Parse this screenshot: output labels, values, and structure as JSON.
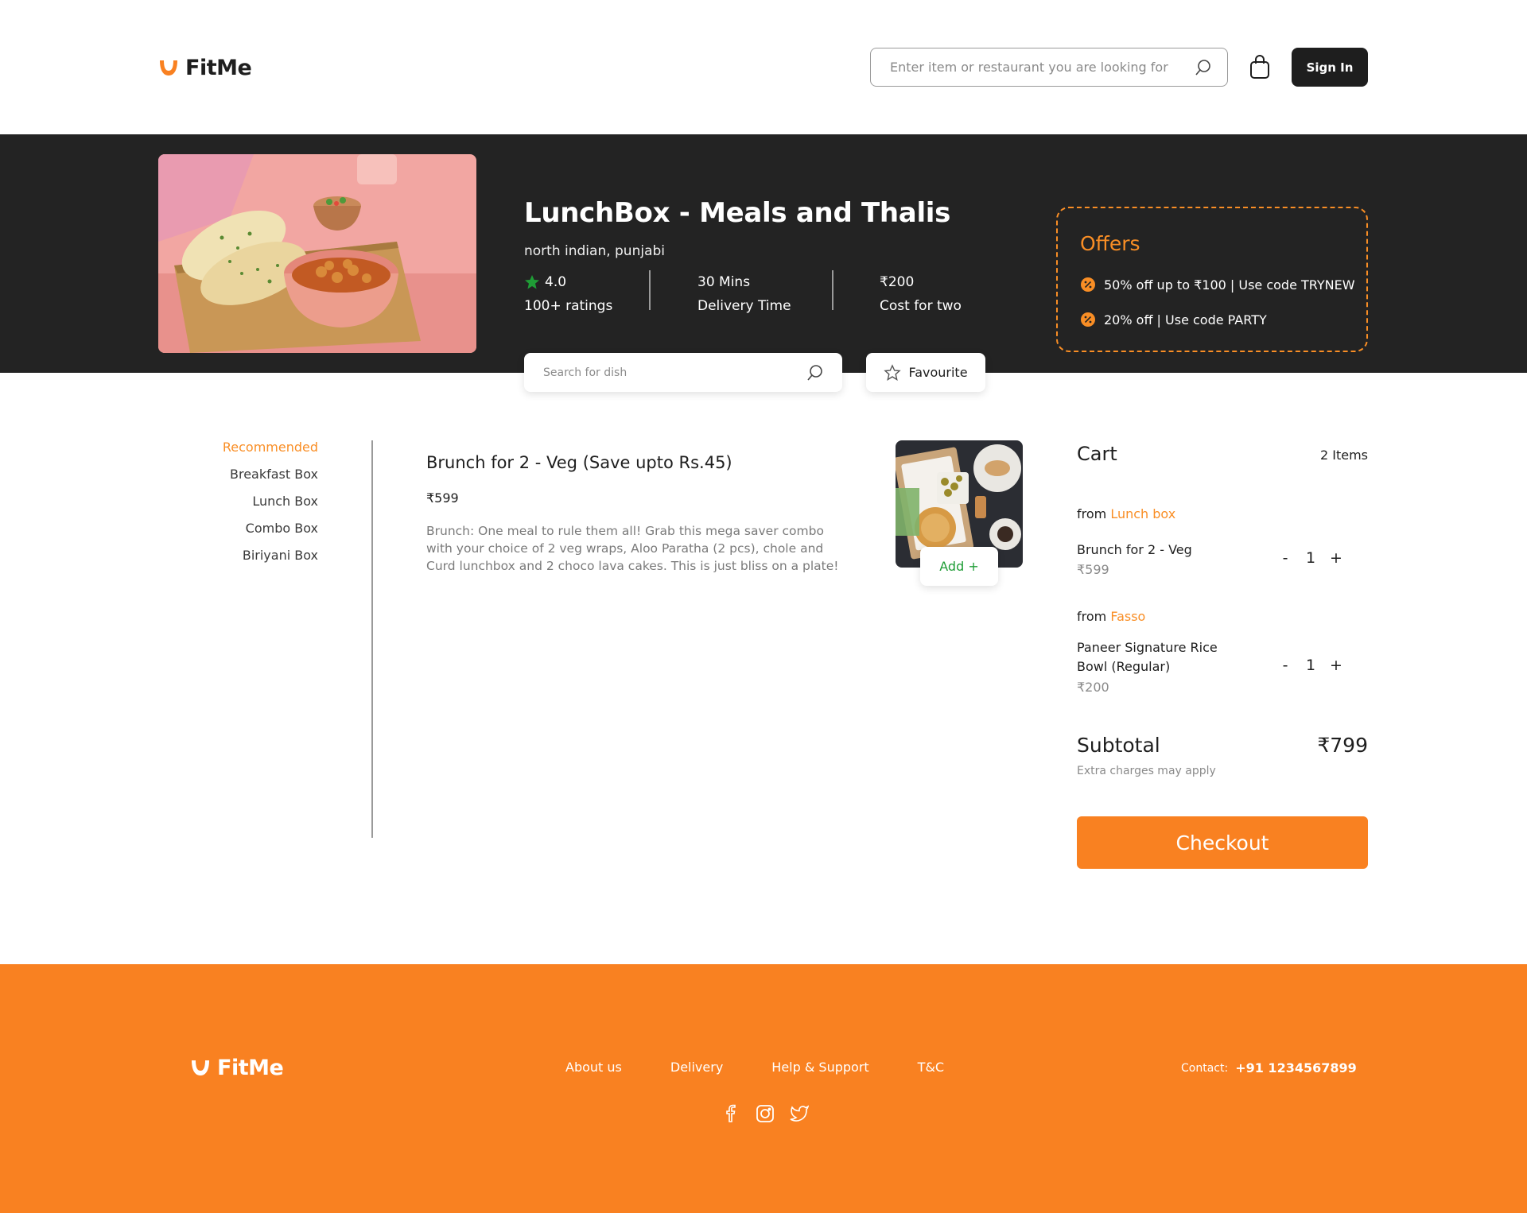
{
  "header": {
    "brand": "FitMe",
    "search_placeholder": "Enter item or restaurant you are looking for",
    "signin_label": "Sign In"
  },
  "restaurant": {
    "name": "LunchBox - Meals and Thalis",
    "cuisine": "north indian, punjabi",
    "rating": "4.0",
    "ratings_count": "100+ ratings",
    "delivery_value": "30 Mins",
    "delivery_label": "Delivery Time",
    "cost_value": "₹200",
    "cost_label": "Cost for two",
    "dish_search_placeholder": "Search for dish",
    "favourite_label": "Favourite"
  },
  "offers": {
    "title": "Offers",
    "items": [
      "50% off up to ₹100 | Use code TRYNEW",
      "20% off | Use code PARTY"
    ]
  },
  "categories": [
    {
      "label": "Recommended",
      "active": true
    },
    {
      "label": "Breakfast Box",
      "active": false
    },
    {
      "label": "Lunch Box",
      "active": false
    },
    {
      "label": "Combo Box",
      "active": false
    },
    {
      "label": "Biriyani Box",
      "active": false
    }
  ],
  "menu_item": {
    "title": "Brunch for 2 - Veg (Save upto Rs.45)",
    "price": "₹599",
    "description": "Brunch: One meal to rule them all! Grab this mega saver combo with your choice of 2 veg wraps, Aloo Paratha (2 pcs), chole and Curd lunchbox and 2 choco lava cakes. This is just bliss on a plate!",
    "add_label": "Add +"
  },
  "cart": {
    "title": "Cart",
    "count": "2 Items",
    "from_label": "from",
    "groups": [
      {
        "source": "Lunch box",
        "item": "Brunch for 2 - Veg",
        "price": "₹599",
        "qty": "1"
      },
      {
        "source": "Fasso",
        "item": "Paneer Signature Rice Bowl (Regular)",
        "price": "₹200",
        "qty": "1"
      }
    ],
    "minus": "-",
    "plus": "+",
    "subtotal_label": "Subtotal",
    "subtotal_value": "₹799",
    "extra_note": "Extra charges may apply",
    "checkout_label": "Checkout"
  },
  "footer": {
    "brand": "FitMe",
    "links": [
      "About us",
      "Delivery",
      "Help & Support",
      "T&C"
    ],
    "social": [
      "facebook-icon",
      "instagram-icon",
      "twitter-icon"
    ],
    "contact_label": "Contact:",
    "contact_number": "+91 1234567899"
  },
  "colors": {
    "accent": "#f98121",
    "dark": "#232323",
    "green": "#1f9d36"
  }
}
